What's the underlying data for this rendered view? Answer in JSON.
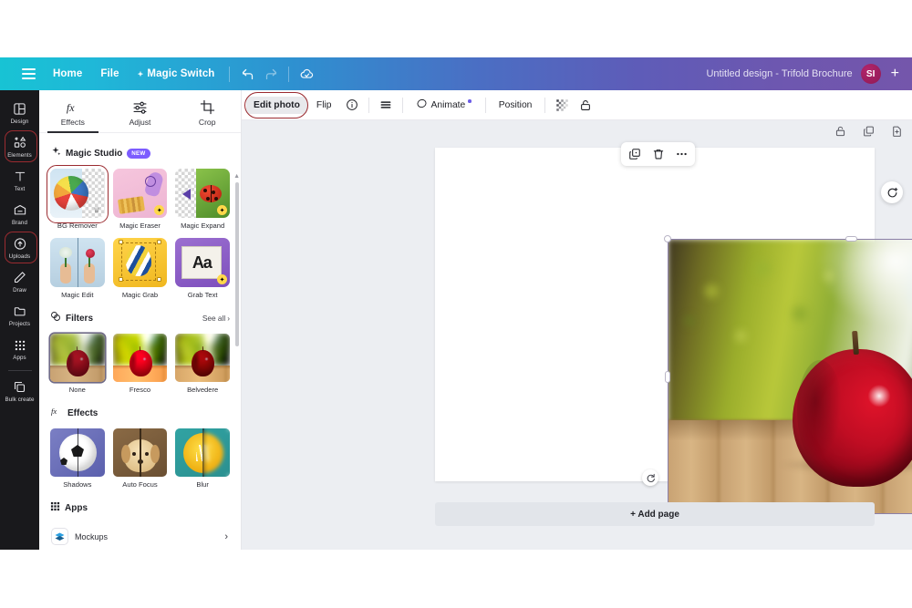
{
  "header": {
    "menu_icon": "hamburger-icon",
    "nav": [
      {
        "label": "Home",
        "name": "nav-home"
      },
      {
        "label": "File",
        "name": "nav-file"
      },
      {
        "label": "Magic Switch",
        "name": "nav-magic-switch"
      }
    ],
    "undo_icon": "undo-icon",
    "redo_icon": "redo-icon",
    "cloud_icon": "cloud-sync-icon",
    "doc_title": "Untitled design - Trifold Brochure",
    "avatar_initials": "SI",
    "add_label": "+",
    "gradient_start": "#18c3d4",
    "gradient_end": "#7456ab"
  },
  "rail": {
    "items": [
      {
        "label": "Design",
        "name": "sidebar-item-design",
        "highlighted": false
      },
      {
        "label": "Elements",
        "name": "sidebar-item-elements",
        "highlighted": true
      },
      {
        "label": "Text",
        "name": "sidebar-item-text",
        "highlighted": false
      },
      {
        "label": "Brand",
        "name": "sidebar-item-brand",
        "highlighted": false
      },
      {
        "label": "Uploads",
        "name": "sidebar-item-uploads",
        "highlighted": true
      },
      {
        "label": "Draw",
        "name": "sidebar-item-draw",
        "highlighted": false
      },
      {
        "label": "Projects",
        "name": "sidebar-item-projects",
        "highlighted": false
      },
      {
        "label": "Apps",
        "name": "sidebar-item-apps",
        "highlighted": false
      },
      {
        "label": "Bulk create",
        "name": "sidebar-item-bulk-create",
        "highlighted": false
      }
    ],
    "highlight_color": "#9b2b30",
    "background": "#19191c"
  },
  "panel": {
    "tabs": [
      {
        "label": "Effects",
        "icon": "fx-icon",
        "active": true
      },
      {
        "label": "Adjust",
        "icon": "sliders-icon",
        "active": false
      },
      {
        "label": "Crop",
        "icon": "crop-icon",
        "active": false
      }
    ],
    "magic_studio": {
      "title": "Magic Studio",
      "badge": "NEW",
      "badge_color": "#7c5cff",
      "items": [
        {
          "label": "BG Remover",
          "selected": true
        },
        {
          "label": "Magic Eraser",
          "selected": false
        },
        {
          "label": "Magic Expand",
          "selected": false
        },
        {
          "label": "Magic Edit",
          "selected": false
        },
        {
          "label": "Magic Grab",
          "selected": false
        },
        {
          "label": "Grab Text",
          "selected": false
        }
      ]
    },
    "filters": {
      "title": "Filters",
      "see_all": "See all",
      "items": [
        {
          "label": "None",
          "selected": true
        },
        {
          "label": "Fresco",
          "selected": false
        },
        {
          "label": "Belvedere",
          "selected": false
        }
      ]
    },
    "effects": {
      "title": "Effects",
      "items": [
        {
          "label": "Shadows"
        },
        {
          "label": "Auto Focus"
        },
        {
          "label": "Blur"
        }
      ]
    },
    "apps": {
      "title": "Apps",
      "items": [
        {
          "label": "Mockups",
          "icon": "mockups-icon"
        }
      ]
    }
  },
  "toolbar": {
    "edit_photo_label": "Edit photo",
    "flip_label": "Flip",
    "info_icon": "info-icon",
    "list_icon": "transparency-icon",
    "animate_label": "Animate",
    "position_label": "Position",
    "grid_icon": "transparency-grid-icon",
    "lock_icon": "lock-icon",
    "highlight_color": "#9b2b30"
  },
  "page_controls": {
    "lock_icon": "lock-icon",
    "duplicate_icon": "duplicate-page-icon",
    "add_page_icon": "add-page-icon"
  },
  "float_toolbar": {
    "duplicate_icon": "duplicate-icon",
    "delete_icon": "trash-icon",
    "more_icon": "more-options-icon"
  },
  "canvas": {
    "rotate_icon": "rotate-handle-icon",
    "magic_icon": "magic-regenerate-icon",
    "add_page_label": "+ Add page",
    "photo_alt": "red-apple-on-wooden-deck-photo",
    "selection_border_color": "#8b7fa8"
  }
}
